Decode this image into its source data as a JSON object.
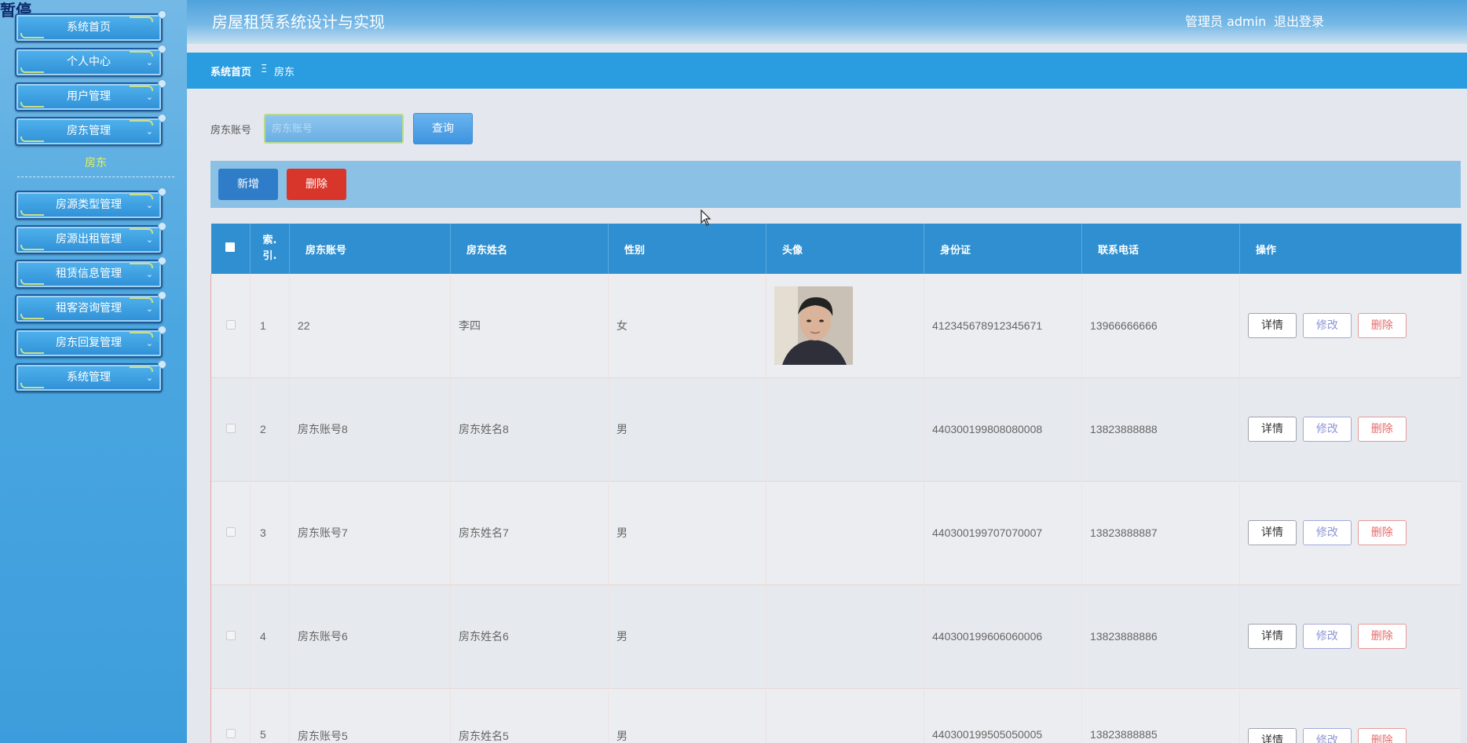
{
  "overlay": {
    "pause_label": "暂停"
  },
  "header": {
    "title": "房屋租赁系统设计与实现",
    "admin_label": "管理员 admin",
    "logout_label": "退出登录"
  },
  "sidebar": {
    "items": [
      {
        "label": "系统首页"
      },
      {
        "label": "个人中心"
      },
      {
        "label": "用户管理"
      },
      {
        "label": "房东管理"
      },
      {
        "label": "房源类型管理"
      },
      {
        "label": "房源出租管理"
      },
      {
        "label": "租赁信息管理"
      },
      {
        "label": "租客咨询管理"
      },
      {
        "label": "房东回复管理"
      },
      {
        "label": "系统管理"
      }
    ],
    "submenu_active": "房东"
  },
  "breadcrumb": {
    "home": "系统首页",
    "separator": "Ξ",
    "current": "房东"
  },
  "search": {
    "label": "房东账号",
    "placeholder": "房东账号",
    "value": "",
    "button": "查询"
  },
  "actions": {
    "add": "新增",
    "delete": "删除"
  },
  "table": {
    "columns": [
      "",
      "索引",
      "房东账号",
      "房东姓名",
      "性别",
      "头像",
      "身份证",
      "联系电话",
      "操作"
    ],
    "index_header": "索.\n引.",
    "rows": [
      {
        "index": "1",
        "account": "22",
        "name": "李四",
        "gender": "女",
        "id_card": "412345678912345671",
        "phone": "13966666666",
        "has_avatar": true
      },
      {
        "index": "2",
        "account": "房东账号8",
        "name": "房东姓名8",
        "gender": "男",
        "id_card": "440300199808080008",
        "phone": "13823888888",
        "has_avatar": false
      },
      {
        "index": "3",
        "account": "房东账号7",
        "name": "房东姓名7",
        "gender": "男",
        "id_card": "440300199707070007",
        "phone": "13823888887",
        "has_avatar": false
      },
      {
        "index": "4",
        "account": "房东账号6",
        "name": "房东姓名6",
        "gender": "男",
        "id_card": "440300199606060006",
        "phone": "13823888886",
        "has_avatar": false
      },
      {
        "index": "5",
        "account": "房东账号5",
        "name": "房东姓名5",
        "gender": "男",
        "id_card": "440300199505050005",
        "phone": "13823888885",
        "has_avatar": false
      }
    ],
    "row_actions": {
      "detail": "详情",
      "edit": "修改",
      "delete": "删除"
    }
  },
  "colors": {
    "sidebar": "#4aa6e0",
    "header": "#4fa2dc",
    "breadcrumb": "#2a9de0",
    "table_header": "#2f8fd0",
    "delete_button": "#d9362b",
    "add_button": "#2f7cc8"
  }
}
